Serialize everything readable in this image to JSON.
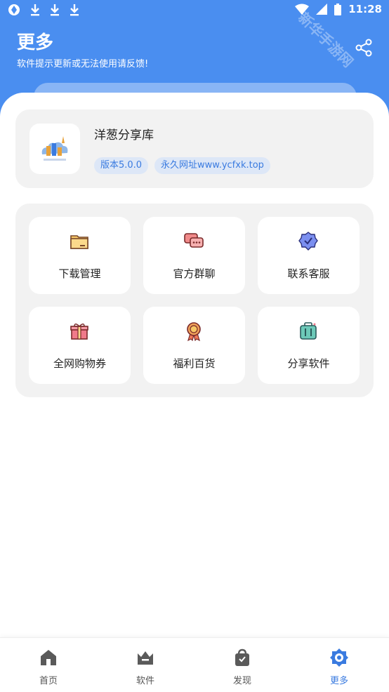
{
  "status_bar": {
    "time": "11:28"
  },
  "watermark": "新华手游网",
  "header": {
    "title": "更多",
    "subtitle": "软件提示更新或无法使用请反馈!"
  },
  "app": {
    "name": "洋葱分享库",
    "version": "版本5.0.0",
    "url": "永久网址www.ycfxk.top"
  },
  "grid": {
    "items": [
      {
        "label": "下载管理",
        "icon": "folder-icon"
      },
      {
        "label": "官方群聊",
        "icon": "chat-icon"
      },
      {
        "label": "联系客服",
        "icon": "verified-badge-icon"
      },
      {
        "label": "全网购物券",
        "icon": "gift-icon"
      },
      {
        "label": "福利百货",
        "icon": "medal-icon"
      },
      {
        "label": "分享软件",
        "icon": "suitcase-icon"
      }
    ]
  },
  "nav": {
    "items": [
      {
        "label": "首页",
        "icon": "home-icon"
      },
      {
        "label": "软件",
        "icon": "crown-icon"
      },
      {
        "label": "发现",
        "icon": "bag-icon"
      },
      {
        "label": "更多",
        "icon": "more-icon",
        "active": true
      }
    ]
  },
  "colors": {
    "accent": "#4a8ef0",
    "badge_text": "#3a7be0"
  }
}
